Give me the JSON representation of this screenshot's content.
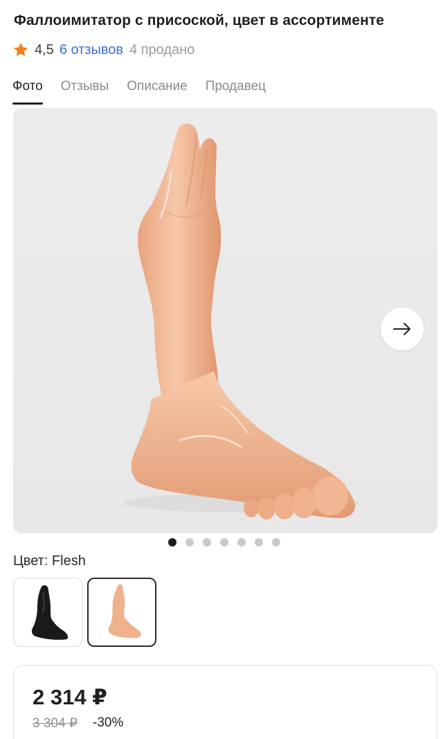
{
  "product": {
    "title": "Фаллоимитатор с присоской, цвет в ассортименте",
    "rating": "4,5",
    "reviews_label": "6 отзывов",
    "sold_label": "4 продано"
  },
  "tabs": [
    {
      "label": "Фото",
      "active": true
    },
    {
      "label": "Отзывы",
      "active": false
    },
    {
      "label": "Описание",
      "active": false
    },
    {
      "label": "Продавец",
      "active": false
    }
  ],
  "gallery": {
    "image_count": 7,
    "current_index": 1
  },
  "variant": {
    "color_label": "Цвет: Flesh",
    "options": [
      {
        "name": "Black",
        "color": "#1a1a1a",
        "selected": false
      },
      {
        "name": "Flesh",
        "color": "#f0b898",
        "selected": true
      }
    ]
  },
  "pricing": {
    "price": "2 314 ₽",
    "old_price": "3 304 ₽",
    "discount": "-30%"
  },
  "colors": {
    "accent_star": "#f57c1f",
    "link": "#3b6fd8",
    "text_primary": "#1f1f1f",
    "text_secondary": "#8a8a8a"
  },
  "icons": {
    "rating": "star-icon",
    "next": "arrow-right-icon"
  }
}
